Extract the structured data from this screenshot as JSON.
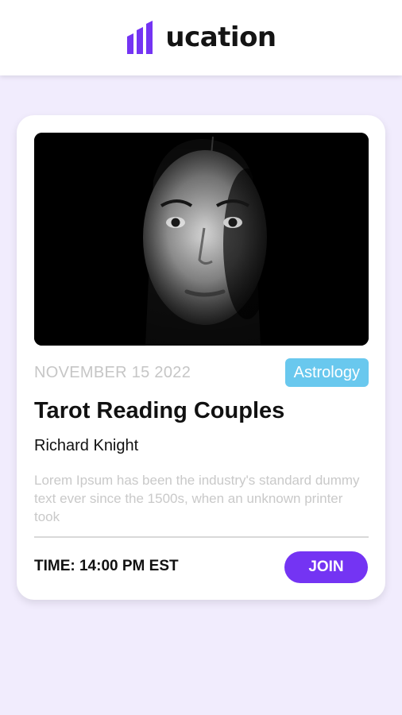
{
  "header": {
    "brand": "ucation",
    "logo_icon": "bar-chart-logo-icon"
  },
  "event": {
    "image": "portrait-photo",
    "date": "NOVEMBER 15 2022",
    "category": "Astrology",
    "title": "Tarot Reading Couples",
    "host": "Richard Knight",
    "description": "Lorem Ipsum has been the industry's standard dummy text ever since the 1500s, when an unknown printer took",
    "time": "TIME: 14:00 PM EST",
    "join_label": "JOIN"
  },
  "colors": {
    "background": "#f1ecfd",
    "accent": "#7434f3",
    "tag": "#69c8ee",
    "muted_text": "#c6c6c6"
  }
}
